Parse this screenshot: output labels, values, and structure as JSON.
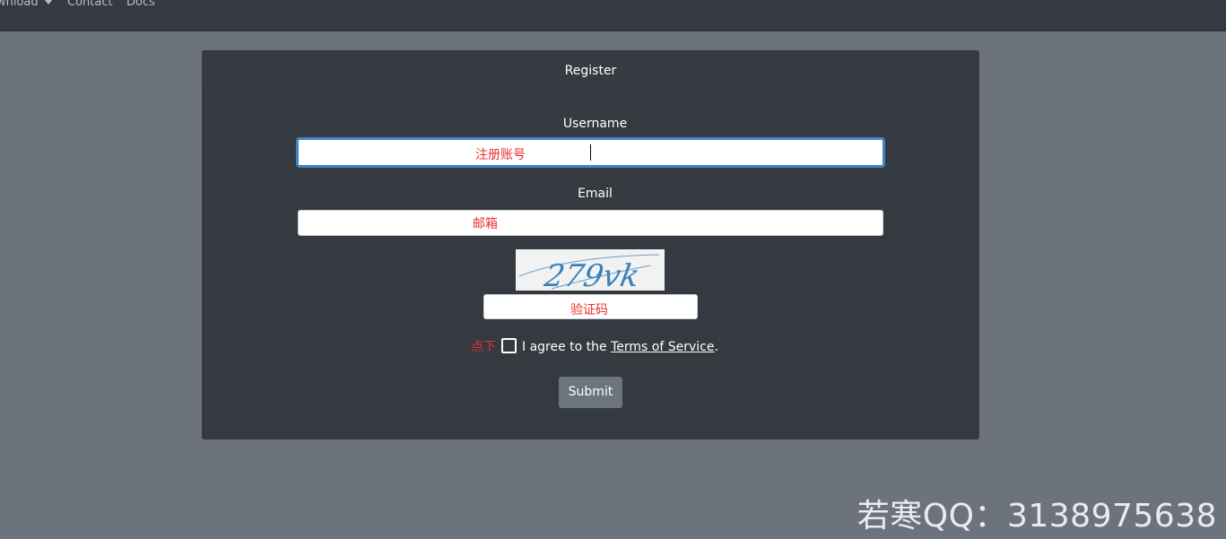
{
  "nav": {
    "items": [
      {
        "label": "wnload",
        "has_caret": true
      },
      {
        "label": "Contact"
      },
      {
        "label": "Docs"
      }
    ]
  },
  "card": {
    "title": "Register",
    "username": {
      "label": "Username",
      "placeholder": "注册账号"
    },
    "email": {
      "label": "Email",
      "placeholder": "邮箱"
    },
    "captcha": {
      "image_text": "279vk",
      "placeholder": "验证码"
    },
    "terms": {
      "hint": "点下",
      "text_before": "I agree to the ",
      "link": "Terms of Service",
      "text_after": "."
    },
    "submit_label": "Submit"
  },
  "watermark": "若寒QQ：3138975638",
  "colors": {
    "navbar": "#343a40",
    "page_bg": "#6c737c",
    "card_bg": "#343a40",
    "accent_red": "#e8322d",
    "focus_blue": "#3d85c6",
    "button": "#6c757d"
  }
}
